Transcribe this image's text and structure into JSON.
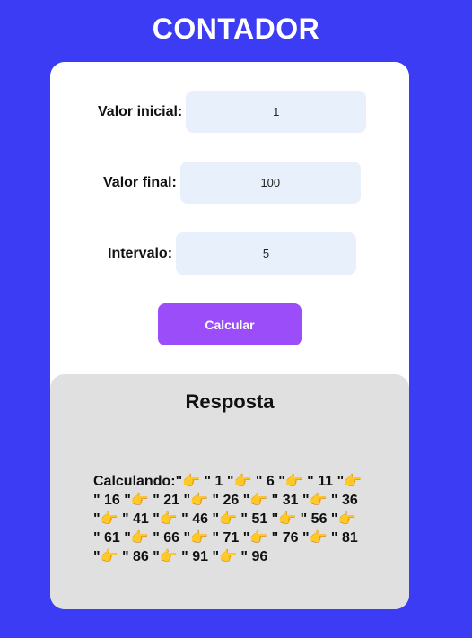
{
  "header": {
    "title": "CONTADOR"
  },
  "form": {
    "start_label": "Valor inicial:",
    "start_value": "1",
    "end_label": "Valor final:",
    "end_value": "100",
    "step_label": "Intervalo:",
    "step_value": "5",
    "calc_button_label": "Calcular"
  },
  "result": {
    "title": "Resposta",
    "text": "Calculando:\"👉 \" 1 \"👉 \" 6 \"👉 \" 11 \"👉 \" 16 \"👉 \" 21 \"👉 \" 26 \"👉 \" 31 \"👉 \" 36 \"👉 \" 41 \"👉 \" 46 \"👉 \" 51 \"👉 \" 56 \"👉 \" 61 \"👉 \" 66 \"👉 \" 71 \"👉 \" 76 \"👉 \" 81 \"👉 \" 86 \"👉 \" 91 \"👉 \" 96"
  },
  "colors": {
    "background": "#3c3cf5",
    "card": "#ffffff",
    "input": "#e8f0fc",
    "button": "#9b4dfa",
    "result_panel": "#e0e0e0"
  }
}
